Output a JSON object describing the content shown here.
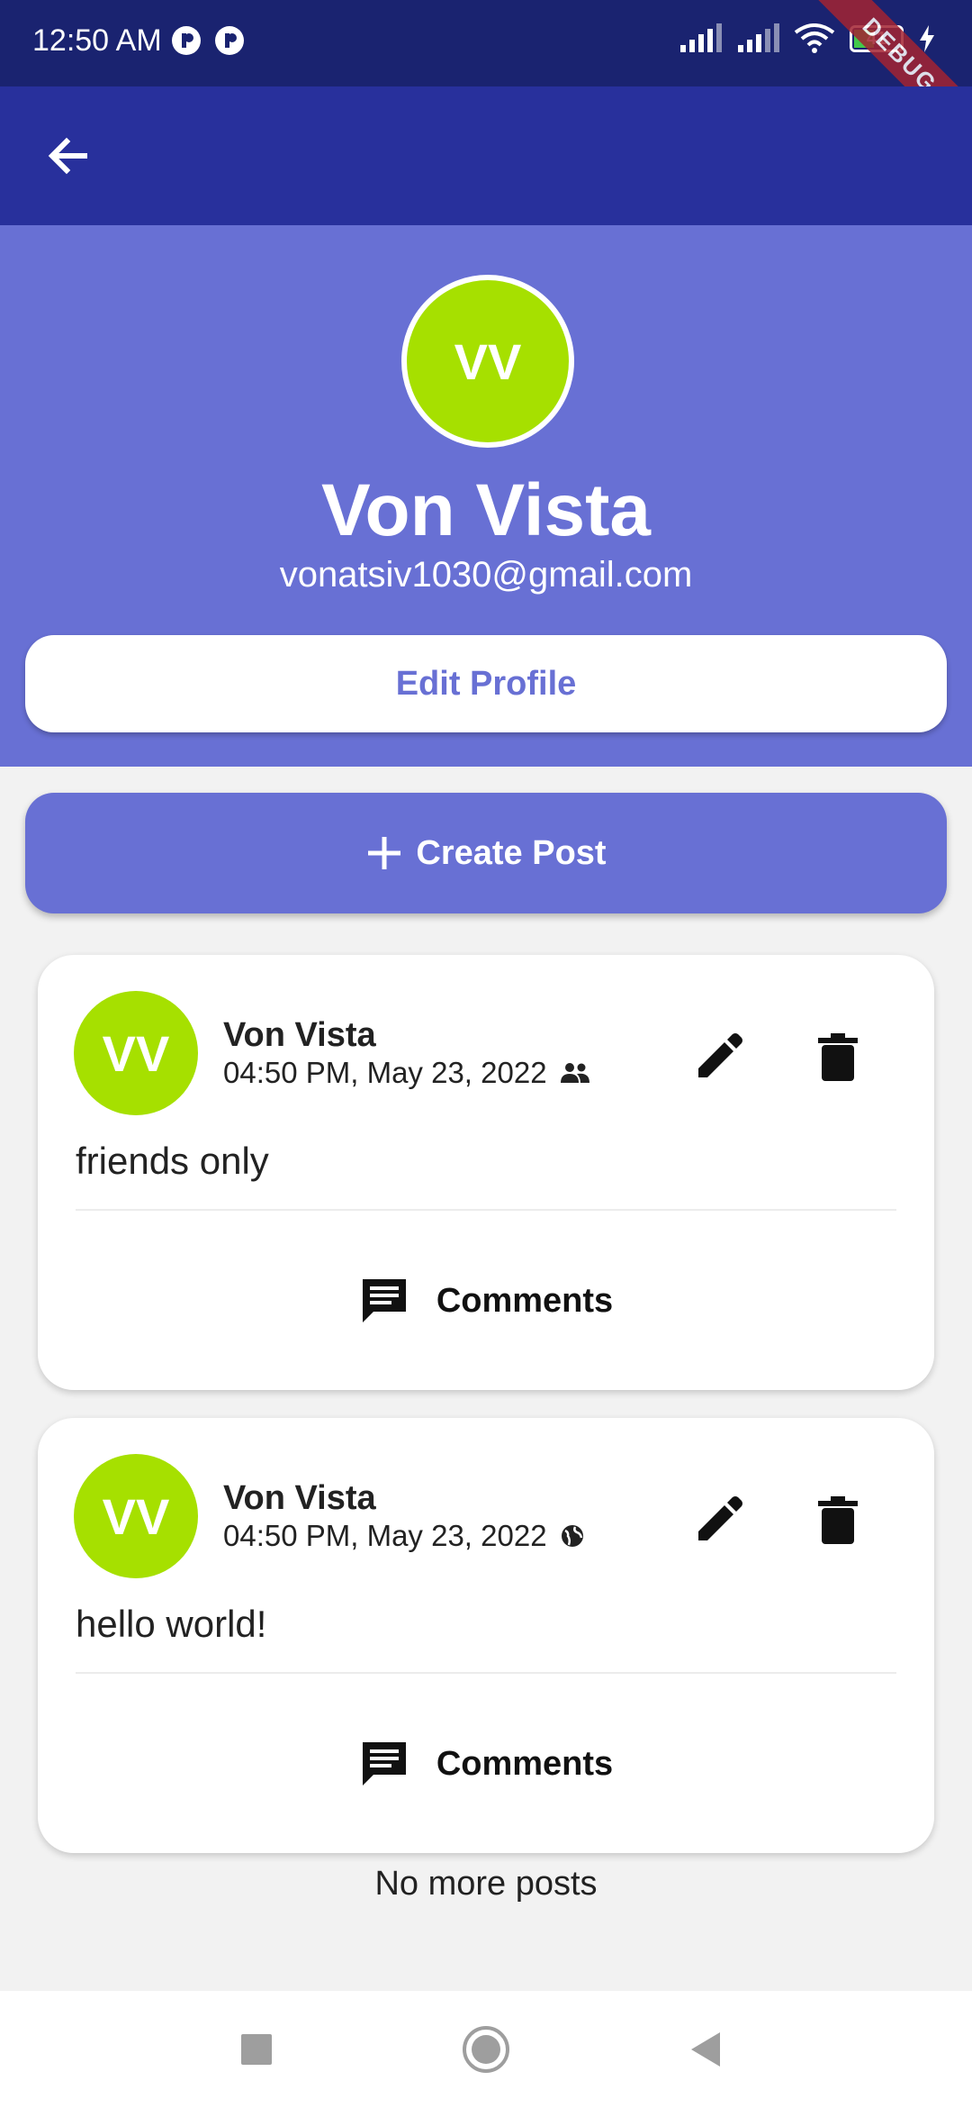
{
  "status_bar": {
    "time": "12:50 AM",
    "battery": "41",
    "debug_banner": "DEBUG"
  },
  "profile": {
    "initials": "VV",
    "name": "Von Vista",
    "email": "vonatsiv1030@gmail.com",
    "edit_button": "Edit Profile"
  },
  "create_post_label": "Create Post",
  "posts": [
    {
      "initials": "VV",
      "author": "Von Vista",
      "timestamp": "04:50 PM, May 23, 2022",
      "visibility_icon": "friends-icon",
      "text": "friends only",
      "comments_label": "Comments"
    },
    {
      "initials": "VV",
      "author": "Von Vista",
      "timestamp": "04:50 PM, May 23, 2022",
      "visibility_icon": "globe-icon",
      "text": "hello world!",
      "comments_label": "Comments"
    }
  ],
  "footer_text": "No more posts",
  "colors": {
    "status_bar": "#1a2370",
    "app_bar": "#28309c",
    "primary": "#6870d4",
    "avatar": "#a6e000"
  }
}
